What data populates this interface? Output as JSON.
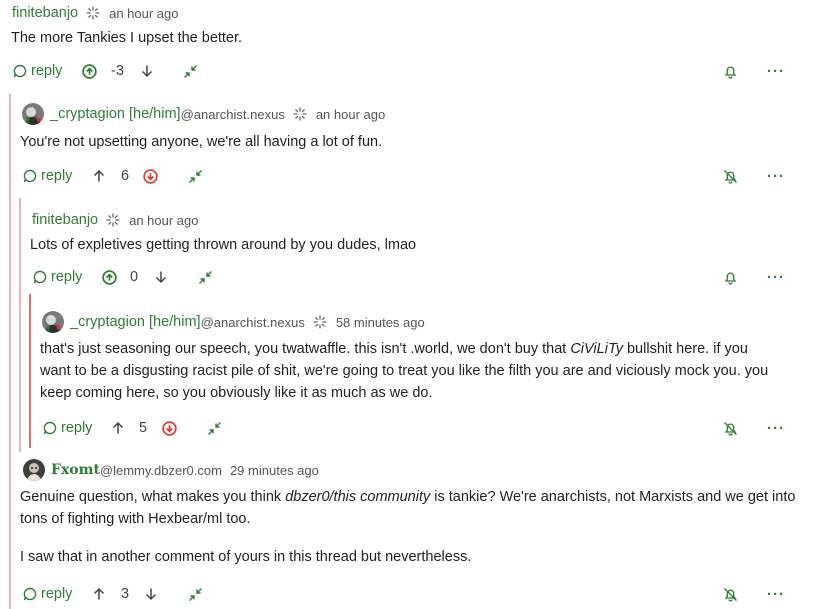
{
  "actions": {
    "reply_label": "reply"
  },
  "comments": [
    {
      "author": "finitebanjo",
      "time": "an hour ago",
      "body": [
        "The more Tankies I upset the better."
      ],
      "score": "-3"
    },
    {
      "author": "_cryptagion [he/him]",
      "domain": "@anarchist.nexus",
      "time": "an hour ago",
      "body": [
        "You're not upsetting anyone, we're all having a lot of fun."
      ],
      "score": "6"
    },
    {
      "author": "finitebanjo",
      "time": "an hour ago",
      "body": [
        "Lots of expletives getting thrown around by you dudes, lmao"
      ],
      "score": "0"
    },
    {
      "author": "_cryptagion [he/him]",
      "domain": "@anarchist.nexus",
      "time": "58 minutes ago",
      "body_pre": "that's just seasoning our speech, you twatwaffle. this isn't .world, we don't buy that ",
      "body_em": "CiViLiTy",
      "body_post": " bullshit here. if you want to be a disgusting racist pile of shit, we're going to treat you like the filth you are and viciously mock you. you keep coming here, so you obviously like it as much as we do.",
      "score": "5"
    },
    {
      "author": "Fxomt",
      "domain": "@lemmy.dbzer0.com",
      "time": "29 minutes ago",
      "body_pre": "Genuine question, what makes you think ",
      "body_em": "dbzer0/this community",
      "body_post": " is tankie? We're anarchists, not Marxists and we get into tons of fighting with Hexbear/ml too.",
      "body2": "I saw that in another comment of yours in this thread but nevertheless.",
      "score": "3"
    }
  ],
  "colors": {
    "green": "#2e7d32",
    "red": "#e53935",
    "thread_pink": "#e8b4bc",
    "thread_red": "#e07070",
    "text": "#222222"
  }
}
